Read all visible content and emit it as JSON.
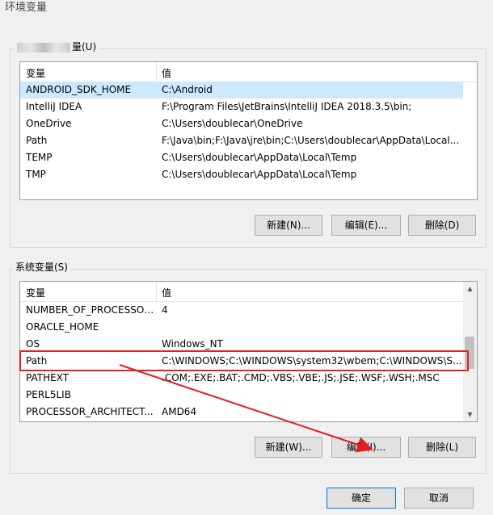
{
  "window": {
    "title": "环境变量"
  },
  "user_section": {
    "label": "量(U)",
    "columns": [
      "变量",
      "值"
    ],
    "rows": [
      {
        "name": "ANDROID_SDK_HOME",
        "value": "C:\\Android"
      },
      {
        "name": "IntelliJ IDEA",
        "value": "F:\\Program Files\\JetBrains\\IntelliJ IDEA 2018.3.5\\bin;"
      },
      {
        "name": "OneDrive",
        "value": "C:\\Users\\doublecar\\OneDrive"
      },
      {
        "name": "Path",
        "value": "F:\\Java\\bin;F:\\Java\\jre\\bin;C:\\Users\\doublecar\\AppData\\Local..."
      },
      {
        "name": "TEMP",
        "value": "C:\\Users\\doublecar\\AppData\\Local\\Temp"
      },
      {
        "name": "TMP",
        "value": "C:\\Users\\doublecar\\AppData\\Local\\Temp"
      }
    ],
    "buttons": {
      "new": "新建(N)...",
      "edit": "编辑(E)...",
      "delete": "删除(D)"
    }
  },
  "system_section": {
    "label": "系统变量(S)",
    "columns": [
      "变量",
      "值"
    ],
    "rows": [
      {
        "name": "NUMBER_OF_PROCESSORS",
        "value": "4"
      },
      {
        "name": "ORACLE_HOME",
        "value": ""
      },
      {
        "name": "OS",
        "value": "Windows_NT"
      },
      {
        "name": "Path",
        "value": "C:\\WINDOWS;C:\\WINDOWS\\system32\\wbem;C:\\WINDOWS\\S..."
      },
      {
        "name": "PATHEXT",
        "value": ".COM;.EXE;.BAT;.CMD;.VBS;.VBE;.JS;.JSE;.WSF;.WSH;.MSC"
      },
      {
        "name": "PERL5LIB",
        "value": ""
      },
      {
        "name": "PROCESSOR_ARCHITECT...",
        "value": "AMD64"
      }
    ],
    "buttons": {
      "new": "新建(W)...",
      "edit": "编辑(I)...",
      "delete": "删除(L)"
    }
  },
  "footer": {
    "ok": "确定",
    "cancel": "取消"
  },
  "annotation_color": "#e02020"
}
